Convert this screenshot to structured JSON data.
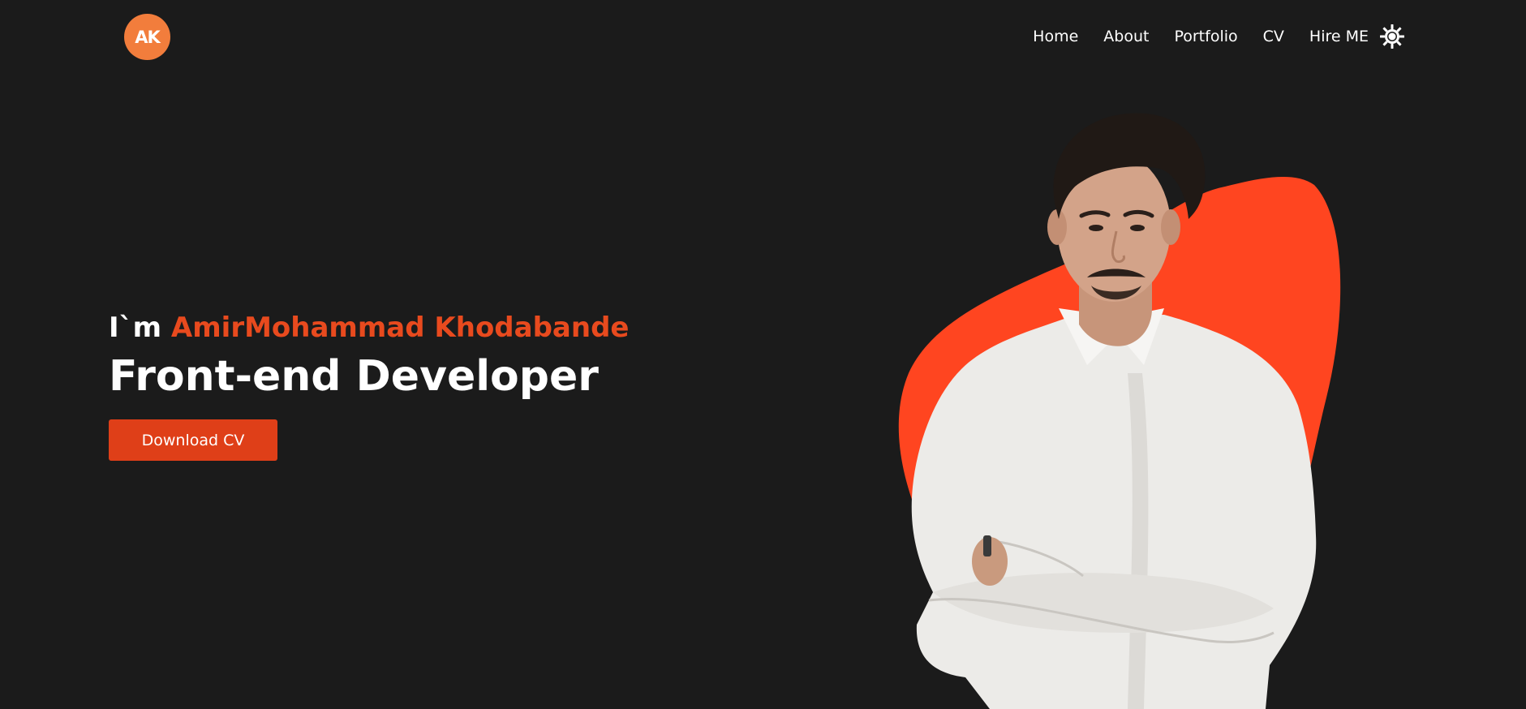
{
  "header": {
    "logo_text": "AK",
    "nav": [
      "Home",
      "About",
      "Portfolio",
      "CV",
      "Hire ME"
    ],
    "theme_icon": "sun-icon"
  },
  "hero": {
    "greeting_prefix": "I`m ",
    "name": "AmirMohammad Khodabande",
    "role": "Front-end Developer",
    "download_label": "Download CV",
    "photo_description_icon": "portrait-photo"
  },
  "colors": {
    "background": "#1b1b1b",
    "accent": "#e84a1e",
    "button": "#df3f18",
    "blob": "#ff4520",
    "logo": "#f27d3c",
    "text": "#ffffff"
  }
}
